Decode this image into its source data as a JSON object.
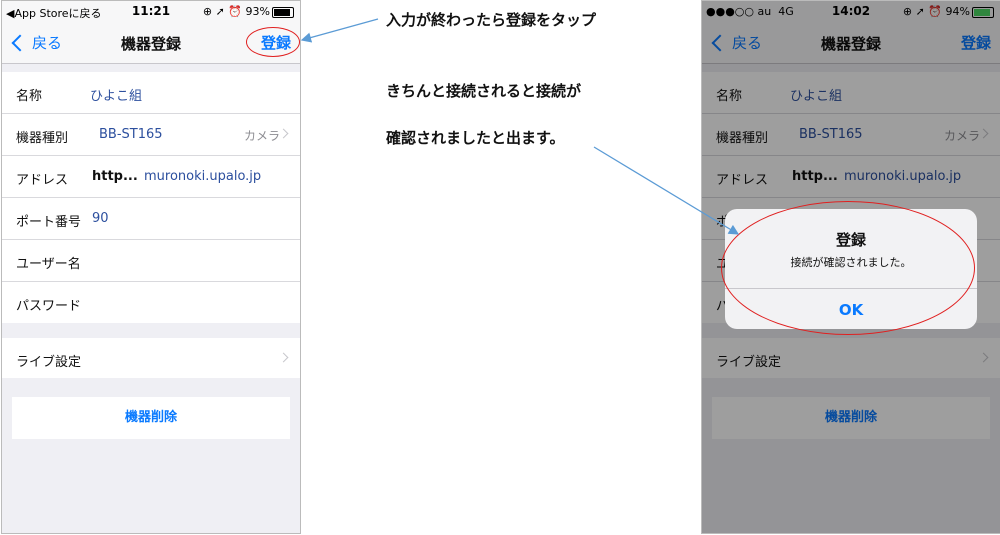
{
  "left_phone": {
    "status": {
      "back_app": "App Storeに戻る",
      "time": "11:21",
      "indicators": "⊕ ➚ ⏰",
      "battery": "93%"
    },
    "nav": {
      "back": "戻る",
      "title": "機器登録",
      "action": "登録"
    },
    "fields": [
      {
        "label": "名称",
        "value": "ひよこ組"
      },
      {
        "label": "機器種別",
        "value": "BB-ST165",
        "hint": "カメラ"
      },
      {
        "label": "アドレス",
        "value_prefix": "http...",
        "value": "muronoki.upalo.jp"
      },
      {
        "label": "ポート番号",
        "value": "90"
      },
      {
        "label": "ユーザー名",
        "value": ""
      },
      {
        "label": "パスワード",
        "value": ""
      }
    ],
    "live_settings": "ライブ設定",
    "delete_button": "機器削除"
  },
  "right_phone": {
    "status": {
      "signal": "●●●○○",
      "carrier": "au",
      "network": "4G",
      "time": "14:02",
      "indicators": "⊕ ➚ ⏰",
      "battery": "94%"
    },
    "nav": {
      "back": "戻る",
      "title": "機器登録",
      "action": "登録"
    },
    "fields": [
      {
        "label": "名称",
        "value": "ひよこ組"
      },
      {
        "label": "機器種別",
        "value": "BB-ST165",
        "hint": "カメラ"
      },
      {
        "label": "アドレス",
        "value_prefix": "http...",
        "value": "muronoki.upalo.jp"
      },
      {
        "label": "ポ",
        "value": ""
      },
      {
        "label": "ユ",
        "value": ""
      },
      {
        "label": "パ",
        "value": ""
      }
    ],
    "live_settings": "ライブ設定",
    "delete_button": "機器削除",
    "alert": {
      "title": "登録",
      "message": "接続が確認されました。",
      "button": "OK"
    }
  },
  "annotations": {
    "note1": "入力が終わったら登録をタップ",
    "note2": "きちんと接続されると接続が",
    "note3": "確認されましたと出ます。"
  },
  "colors": {
    "ios_blue": "#0a7aff",
    "value_blue": "#2c4f9e",
    "annotation_red": "#e02020",
    "arrow_blue": "#5b9bd5",
    "battery_green": "#4cd964"
  }
}
